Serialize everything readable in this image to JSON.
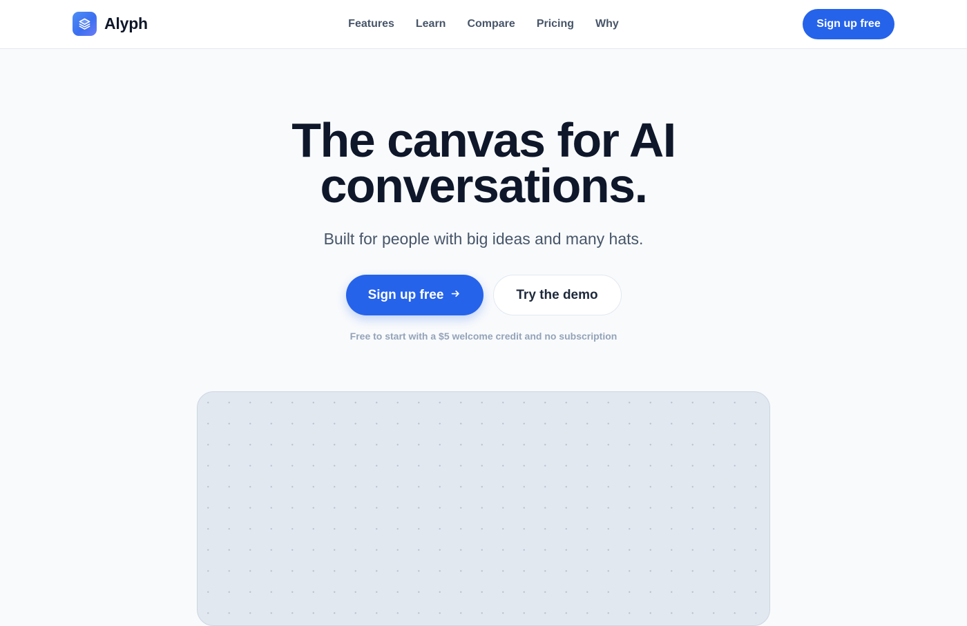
{
  "header": {
    "brand_name": "Alyph",
    "logo_icon": "layers-icon",
    "nav": [
      {
        "label": "Features"
      },
      {
        "label": "Learn"
      },
      {
        "label": "Compare"
      },
      {
        "label": "Pricing"
      },
      {
        "label": "Why"
      }
    ],
    "cta_label": "Sign up free"
  },
  "hero": {
    "title_line1": "The canvas for AI",
    "title_line2": "conversations.",
    "subtitle": "Built for people with big ideas and many hats.",
    "primary_cta_label": "Sign up free",
    "primary_cta_icon": "arrow-right-icon",
    "secondary_cta_label": "Try the demo",
    "fine_print": "Free to start with a $5 welcome credit and no subscription"
  },
  "colors": {
    "accent": "#2563eb",
    "background": "#f8fafc",
    "heading": "#0f172a",
    "muted": "#475569",
    "canvas_bg": "#e2e8f0"
  }
}
